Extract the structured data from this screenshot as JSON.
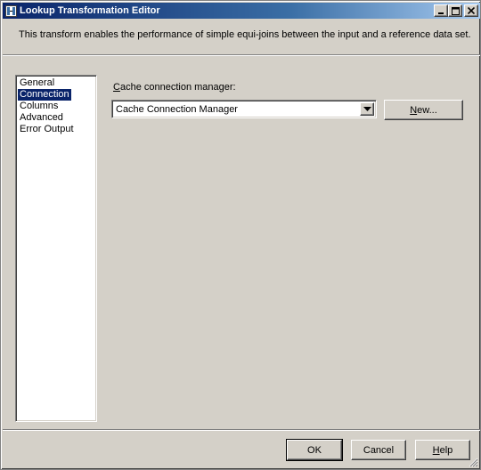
{
  "window": {
    "title": "Lookup Transformation Editor",
    "controls": {
      "minimize": "_",
      "maximize": "□",
      "close": "×"
    }
  },
  "description": "This transform enables the performance of simple equi-joins between the input and a reference data set.",
  "nav": {
    "items": [
      {
        "label": "General",
        "selected": false
      },
      {
        "label": "Connection",
        "selected": true
      },
      {
        "label": "Columns",
        "selected": false
      },
      {
        "label": "Advanced",
        "selected": false
      },
      {
        "label": "Error Output",
        "selected": false
      }
    ]
  },
  "connection": {
    "cache_label_accel": "C",
    "cache_label_rest": "ache connection manager:",
    "combo_value": "Cache Connection Manager",
    "new_button_accel": "N",
    "new_button_rest": "ew..."
  },
  "footer": {
    "ok_label": "OK",
    "cancel_label": "Cancel",
    "help_accel": "H",
    "help_rest": "elp"
  },
  "colors": {
    "title_active": "#0a246a",
    "face": "#d4d0c8",
    "selection": "#0a246a"
  }
}
